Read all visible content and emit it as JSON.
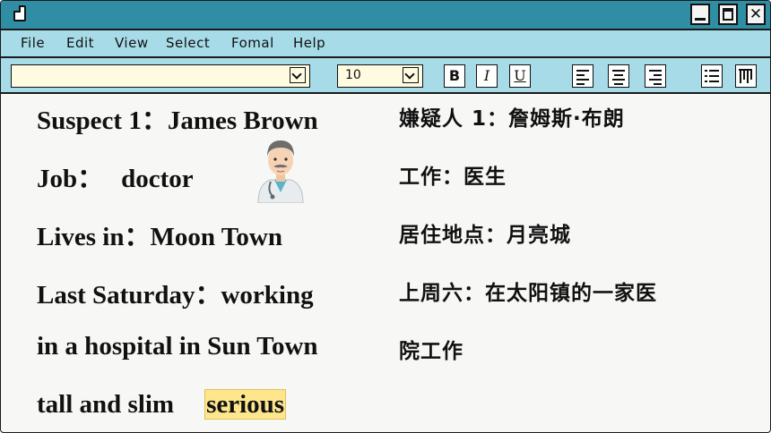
{
  "menu": [
    "File",
    "Edit",
    "View",
    "Select",
    "Fomal",
    "Help"
  ],
  "toolbar": {
    "font_value": "",
    "size_value": "10",
    "bold_label": "B",
    "italic_label": "I",
    "underline_label": "U"
  },
  "content": {
    "english": {
      "suspect_label": "Suspect 1：",
      "suspect_value": "James Brown",
      "job_label": "Job：",
      "job_value": "doctor",
      "lives_label": "Lives in：",
      "lives_value": "Moon Town",
      "saturday_label": "Last Saturday：",
      "saturday_value": "working",
      "saturday_cont": "in a hospital in Sun Town",
      "appearance": "tall and slim",
      "highlighted": "serious"
    },
    "chinese": {
      "line1": "嫌疑人 1：詹姆斯·布朗",
      "line2": "工作：医生",
      "line3": "居住地点：月亮城",
      "line4": "上周六：在太阳镇的一家医",
      "line5": "院工作"
    }
  },
  "icons": {
    "app": "document-icon",
    "avatar": "male-doctor-emoji",
    "bold": "bold-icon",
    "italic": "italic-icon",
    "underline": "underline-icon",
    "align_left": "align-left-icon",
    "align_center": "align-center-icon",
    "align_right": "align-right-icon",
    "list": "bullet-list-icon",
    "columns": "columns-icon"
  },
  "colors": {
    "titlebar": "#2f8ea3",
    "menubar": "#a7dbe8",
    "highlight": "#fde68c",
    "field": "#fffbe0"
  }
}
